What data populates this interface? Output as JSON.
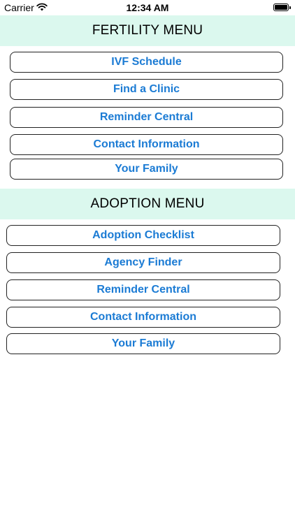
{
  "status_bar": {
    "carrier": "Carrier",
    "time": "12:34 AM",
    "battery_level": 1.0
  },
  "fertility_menu": {
    "title": "FERTILITY MENU",
    "items": [
      "IVF Schedule",
      "Find a Clinic",
      "Reminder Central",
      "Contact Information",
      "Your Family"
    ]
  },
  "adoption_menu": {
    "title": "ADOPTION MENU",
    "items": [
      "Adoption Checklist",
      "Agency Finder",
      "Reminder Central",
      "Contact Information",
      "Your Family"
    ]
  },
  "colors": {
    "header_background": "#dbf8ee",
    "button_text": "#1b7bd4",
    "button_border": "#222222"
  },
  "icons": [
    "wifi-icon",
    "battery-icon"
  ]
}
